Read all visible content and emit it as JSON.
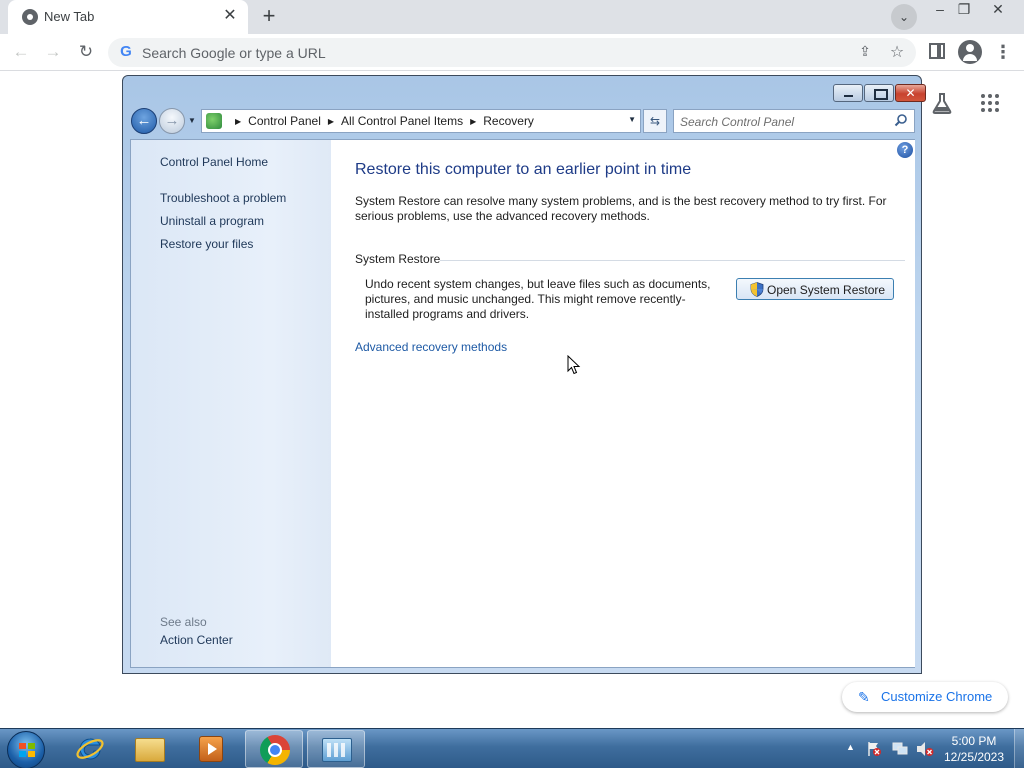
{
  "browser": {
    "tab_title": "New Tab",
    "omnibox_placeholder": "Search Google or type a URL",
    "customize_label": "Customize Chrome"
  },
  "window": {
    "breadcrumbs": [
      "Control Panel",
      "All Control Panel Items",
      "Recovery"
    ],
    "search_placeholder": "Search Control Panel"
  },
  "sidebar": {
    "home_link": "Control Panel Home",
    "tasks": [
      "Troubleshoot a problem",
      "Uninstall a program",
      "Restore your files"
    ],
    "see_also_heading": "See also",
    "see_also_links": [
      "Action Center"
    ]
  },
  "main": {
    "title": "Restore this computer to an earlier point in time",
    "intro": "System Restore can resolve many system problems, and is the best recovery method to try first. For serious problems, use the advanced recovery methods.",
    "system_restore": {
      "heading": "System Restore",
      "description": "Undo recent system changes, but leave files such as documents, pictures, and music unchanged. This might remove recently-installed programs and drivers.",
      "button_label": "Open System Restore"
    },
    "advanced_link": "Advanced recovery methods"
  },
  "taskbar": {
    "pinned": [
      "internet-explorer",
      "windows-explorer",
      "media-player",
      "google-chrome",
      "control-panel"
    ],
    "active": "control-panel",
    "clock_time": "5:00 PM",
    "clock_date": "12/25/2023"
  },
  "colors": {
    "link": "#1e5aa5",
    "title": "#1e3b87",
    "sidebar_text": "#1e3758",
    "chrome_accent": "#1a73e8"
  }
}
